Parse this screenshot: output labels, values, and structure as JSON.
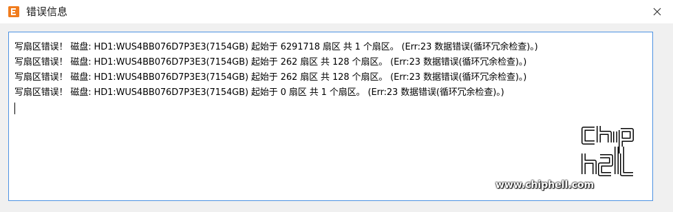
{
  "window": {
    "title": "错误信息",
    "icon": "app-logo-icon",
    "close_icon": "close-icon"
  },
  "messages": [
    "写扇区错误！  磁盘: HD1:WUS4BB076D7P3E3(7154GB) 起始于 6291718 扇区 共 1 个扇区。 (Err:23 数据错误(循环冗余检查)。)",
    "写扇区错误！  磁盘: HD1:WUS4BB076D7P3E3(7154GB) 起始于 262 扇区 共 128 个扇区。 (Err:23 数据错误(循环冗余检查)。)",
    "写扇区错误！  磁盘: HD1:WUS4BB076D7P3E3(7154GB) 起始于 262 扇区 共 128 个扇区。 (Err:23 数据错误(循环冗余检查)。)",
    "写扇区错误！  磁盘: HD1:WUS4BB076D7P3E3(7154GB) 起始于 0 扇区 共 1 个扇区。 (Err:23 数据错误(循环冗余检查)。)"
  ],
  "watermark": {
    "url": "www.chiphell.com",
    "logo": "chiphell"
  },
  "colors": {
    "accent_border": "#4a90e2",
    "icon_orange": "#f07c1e"
  }
}
